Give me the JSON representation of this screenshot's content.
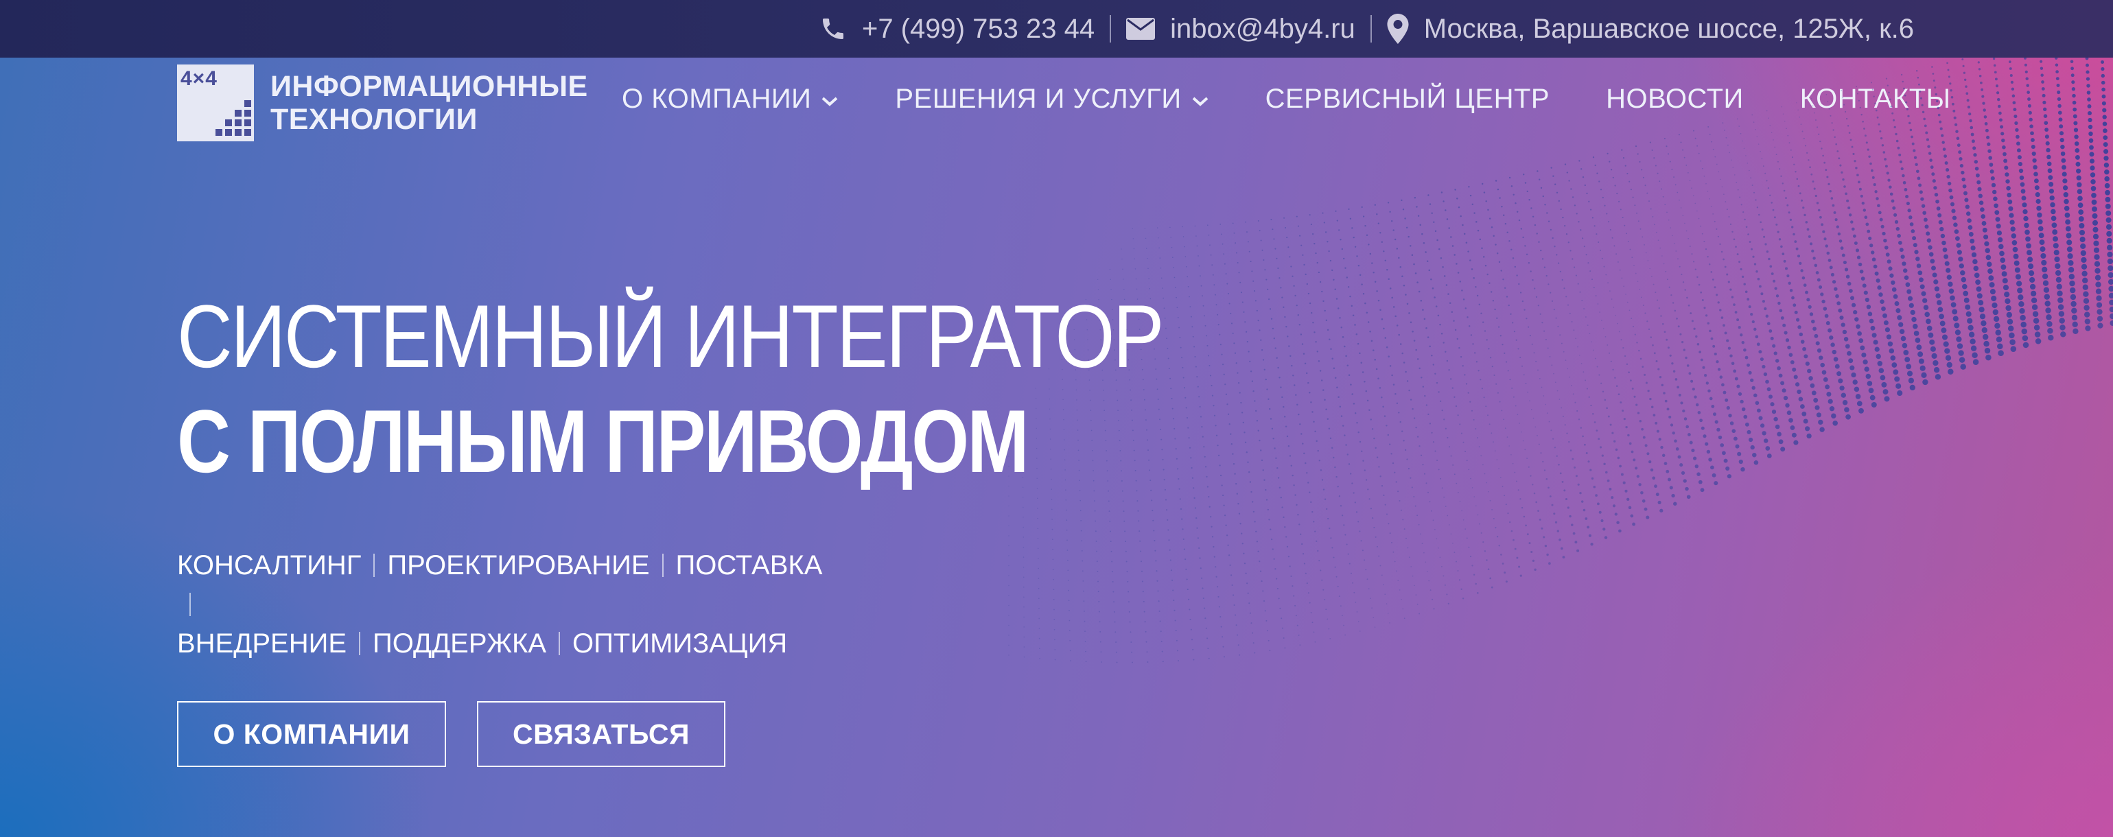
{
  "topbar": {
    "phone": "+7 (499) 753 23 44",
    "email": "inbox@4by4.ru",
    "address": "Москва, Варшавское шоссе, 125Ж, к.6",
    "icons": [
      "phone-icon",
      "envelope-icon",
      "map-pin-icon"
    ]
  },
  "logo": {
    "mark": "4×4",
    "line1": "ИНФОРМАЦИОННЫЕ",
    "line2": "ТЕХНОЛОГИИ"
  },
  "nav": {
    "items": [
      {
        "label": "О КОМПАНИИ",
        "dropdown": true
      },
      {
        "label": "РЕШЕНИЯ И УСЛУГИ",
        "dropdown": true
      },
      {
        "label": "СЕРВИСНЫЙ ЦЕНТР",
        "dropdown": false
      },
      {
        "label": "НОВОСТИ",
        "dropdown": false
      },
      {
        "label": "КОНТАКТЫ",
        "dropdown": false
      }
    ]
  },
  "hero": {
    "title_line1": "СИСТЕМНЫЙ ИНТЕГРАТОР",
    "title_line2": "С ПОЛНЫМ ПРИВОДОМ",
    "services": [
      "КОНСАЛТИНГ",
      "ПРОЕКТИРОВАНИЕ",
      "ПОСТАВКА",
      "ВНЕДРЕНИЕ",
      "ПОДДЕРЖКА",
      "ОПТИМИЗАЦИЯ"
    ]
  },
  "buttons": {
    "about": "О КОМПАНИИ",
    "contact": "СВЯЗАТЬСЯ"
  },
  "colors": {
    "topbar": "#2a2b62",
    "gradient_left": "#3f6fb8",
    "gradient_right": "#b4569f",
    "dots": "#2b3f9a"
  }
}
